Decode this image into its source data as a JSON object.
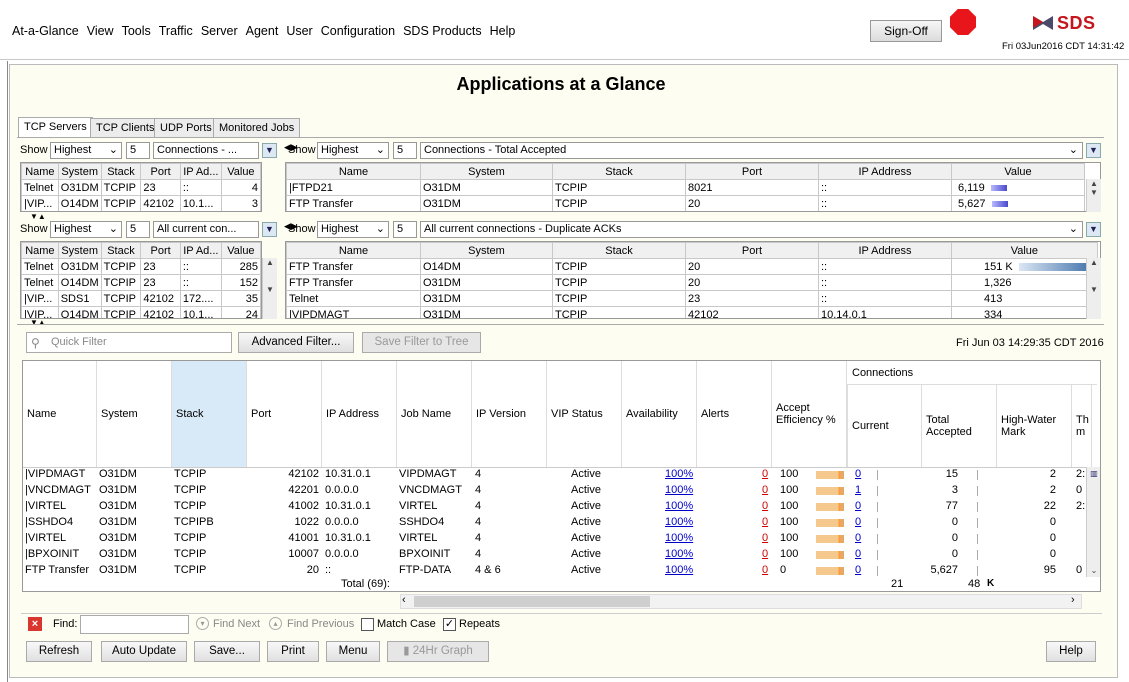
{
  "menu": [
    "At-a-Glance",
    "View",
    "Tools",
    "Traffic",
    "Server",
    "Agent",
    "User",
    "Configuration",
    "SDS Products",
    "Help"
  ],
  "signoff_label": "Sign-Off",
  "logo_text": "SDS",
  "datetime_top": "Fri 03Jun2016 CDT 14:31:42",
  "page_title": "Applications at a Glance",
  "tabs": [
    "TCP Servers",
    "TCP Clients",
    "UDP Ports",
    "Monitored Jobs"
  ],
  "show_label": "Show",
  "panels": [
    {
      "mode": "Highest",
      "count": "5",
      "metric": "Connections - ...",
      "headers": [
        "Name",
        "System",
        "Stack",
        "Port",
        "IP Ad...",
        "Value"
      ],
      "rows": [
        [
          "Telnet",
          "O31DM",
          "TCPIP",
          "23",
          "::",
          "4"
        ],
        [
          "|VIP...",
          "O14DM",
          "TCPIP",
          "42102",
          "10.1...",
          "3"
        ]
      ]
    },
    {
      "mode": "Highest",
      "count": "5",
      "metric": "Connections - Total Accepted",
      "headers": [
        "Name",
        "System",
        "Stack",
        "Port",
        "IP Address",
        "Value"
      ],
      "rows": [
        [
          "|FTPD21",
          "O31DM",
          "TCPIP",
          "8021",
          "::",
          "6,119"
        ],
        [
          "FTP Transfer",
          "O31DM",
          "TCPIP",
          "20",
          "::",
          "5,627"
        ]
      ]
    },
    {
      "mode": "Highest",
      "count": "5",
      "metric": "All current con...",
      "headers": [
        "Name",
        "System",
        "Stack",
        "Port",
        "IP Ad...",
        "Value"
      ],
      "rows": [
        [
          "Telnet",
          "O31DM",
          "TCPIP",
          "23",
          "::",
          "285"
        ],
        [
          "Telnet",
          "O14DM",
          "TCPIP",
          "23",
          "::",
          "152"
        ],
        [
          "|VIP...",
          "SDS1",
          "TCPIP",
          "42102",
          "172....",
          "35"
        ],
        [
          "|VIP...",
          "O14DM",
          "TCPIP",
          "42102",
          "10.1...",
          "24"
        ]
      ]
    },
    {
      "mode": "Highest",
      "count": "5",
      "metric": "All current connections - Duplicate ACKs",
      "headers": [
        "Name",
        "System",
        "Stack",
        "Port",
        "IP Address",
        "Value"
      ],
      "rows": [
        [
          "FTP Transfer",
          "O14DM",
          "TCPIP",
          "20",
          "::",
          "151"
        ],
        [
          "FTP Transfer",
          "O31DM",
          "TCPIP",
          "20",
          "::",
          "1,326"
        ],
        [
          "Telnet",
          "O31DM",
          "TCPIP",
          "23",
          "::",
          "413"
        ],
        [
          "|VIPDMAGT",
          "O31DM",
          "TCPIP",
          "42102",
          "10.14.0.1",
          "334"
        ]
      ],
      "k_label": "K"
    }
  ],
  "quick_filter_placeholder": "Quick Filter",
  "advanced_filter_label": "Advanced Filter...",
  "save_filter_label": "Save Filter to Tree",
  "main_timestamp": "Fri Jun 03 14:29:35 CDT 2016",
  "grid": {
    "connections_group": "Connections",
    "headers": [
      "Name",
      "System",
      "Stack",
      "Port",
      "IP Address",
      "Job Name",
      "IP Version",
      "VIP Status",
      "Availability",
      "Alerts",
      "Accept Efficiency %",
      "Current",
      "Total Accepted",
      "High-Water Mark",
      "Th m"
    ],
    "rows": [
      {
        "name": "|VIPDMAGT",
        "system": "O31DM",
        "stack": "TCPIP",
        "port": "42102",
        "ip": "10.31.0.1",
        "job": "VIPDMAGT",
        "ipver": "4",
        "vip": "Active",
        "avail": "100%",
        "alerts": "0",
        "eff": "100",
        "current": "0",
        "total": "15",
        "hwm": "2",
        "extra": "2:"
      },
      {
        "name": "|VNCDMAGT",
        "system": "O31DM",
        "stack": "TCPIP",
        "port": "42201",
        "ip": "0.0.0.0",
        "job": "VNCDMAGT",
        "ipver": "4",
        "vip": "Active",
        "avail": "100%",
        "alerts": "0",
        "eff": "100",
        "current": "1",
        "total": "3",
        "hwm": "2",
        "extra": "0"
      },
      {
        "name": "|VIRTEL",
        "system": "O31DM",
        "stack": "TCPIP",
        "port": "41002",
        "ip": "10.31.0.1",
        "job": "VIRTEL",
        "ipver": "4",
        "vip": "Active",
        "avail": "100%",
        "alerts": "0",
        "eff": "100",
        "current": "0",
        "total": "77",
        "hwm": "22",
        "extra": "2:"
      },
      {
        "name": "|SSHDO4",
        "system": "O31DM",
        "stack": "TCPIPB",
        "port": "1022",
        "ip": "0.0.0.0",
        "job": "SSHDO4",
        "ipver": "4",
        "vip": "Active",
        "avail": "100%",
        "alerts": "0",
        "eff": "100",
        "current": "0",
        "total": "0",
        "hwm": "0",
        "extra": ""
      },
      {
        "name": "|VIRTEL",
        "system": "O31DM",
        "stack": "TCPIP",
        "port": "41001",
        "ip": "10.31.0.1",
        "job": "VIRTEL",
        "ipver": "4",
        "vip": "Active",
        "avail": "100%",
        "alerts": "0",
        "eff": "100",
        "current": "0",
        "total": "0",
        "hwm": "0",
        "extra": ""
      },
      {
        "name": "|BPXOINIT",
        "system": "O31DM",
        "stack": "TCPIP",
        "port": "10007",
        "ip": "0.0.0.0",
        "job": "BPXOINIT",
        "ipver": "4",
        "vip": "Active",
        "avail": "100%",
        "alerts": "0",
        "eff": "100",
        "current": "0",
        "total": "0",
        "hwm": "0",
        "extra": ""
      },
      {
        "name": "FTP Transfer",
        "system": "O31DM",
        "stack": "TCPIP",
        "port": "20",
        "ip": "::",
        "job": "FTP-DATA",
        "ipver": "4 & 6",
        "vip": "Active",
        "avail": "100%",
        "alerts": "0",
        "eff": "0",
        "current": "0",
        "total": "5,627",
        "hwm": "95",
        "extra": "0"
      }
    ],
    "total_label": "Total  (69):",
    "total_current": "21",
    "total_accepted": "48",
    "total_k": "K"
  },
  "find": {
    "label": "Find:",
    "next": "Find Next",
    "previous": "Find Previous",
    "match_case": "Match Case",
    "repeats": "Repeats"
  },
  "bottom_buttons": [
    "Refresh",
    "Auto Update",
    "Save...",
    "Print",
    "Menu",
    "24Hr Graph",
    "Help"
  ]
}
